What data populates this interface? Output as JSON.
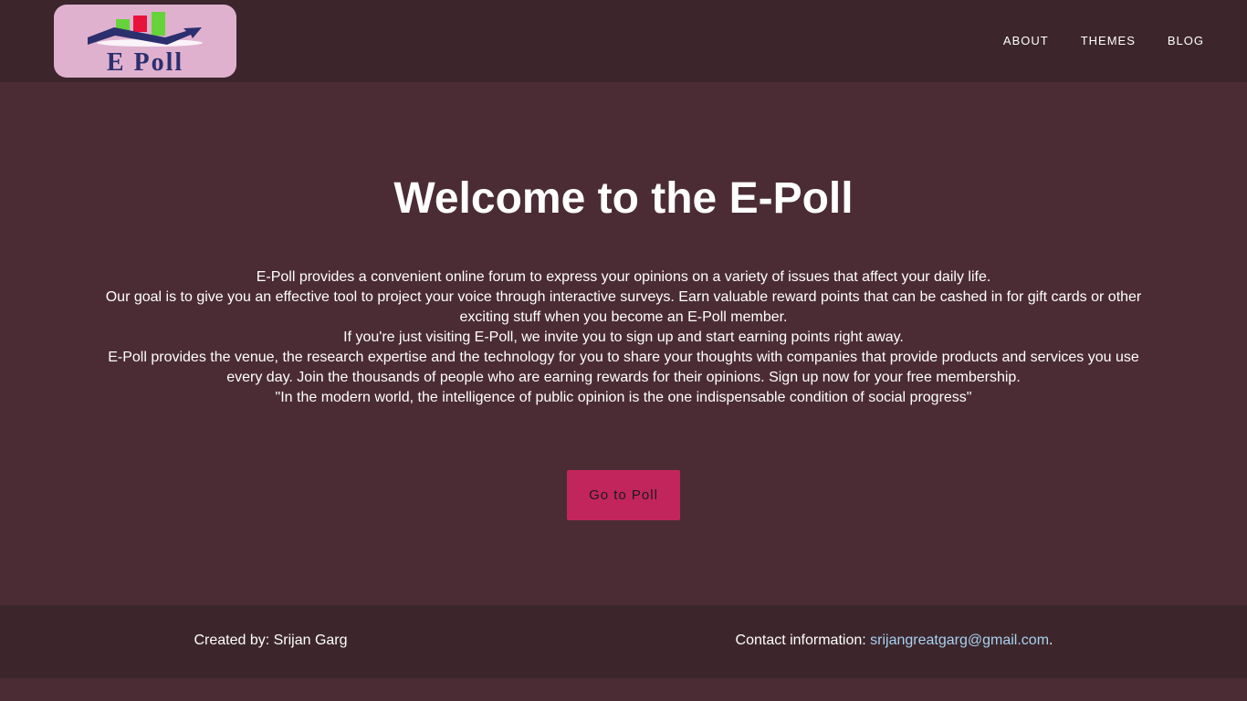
{
  "header": {
    "logo_text": "E Poll",
    "nav": [
      {
        "label": "ABOUT"
      },
      {
        "label": "THEMES"
      },
      {
        "label": "BLOG"
      }
    ]
  },
  "main": {
    "title": "Welcome to the E-Poll",
    "paragraphs": [
      "E-Poll provides a convenient online forum to express your opinions on a variety of issues that affect your daily life.",
      "Our goal is to give you an effective tool to project your voice through interactive surveys. Earn valuable reward points that can be cashed in for gift cards or other exciting stuff when you become an E-Poll member.",
      "If you're just visiting E-Poll, we invite you to sign up and start earning points right away.",
      "E-Poll provides the venue, the research expertise and the technology for you to share your thoughts with companies that provide products and services you use every day. Join the thousands of people who are earning rewards for their opinions. Sign up now for your free membership.",
      "\"In the modern world, the intelligence of public opinion is the one indispensable condition of social progress\""
    ],
    "cta_label": "Go to Poll"
  },
  "footer": {
    "created_by": "Created by: Srijan Garg",
    "contact_label": "Contact information: ",
    "contact_email": "srijangreatgarg@gmail.com",
    "contact_suffix": "."
  },
  "colors": {
    "background": "#4b2c35",
    "nav_background": "#3c262c",
    "button": "#c2255c",
    "link": "#a9d2ef",
    "logo_background": "#dfb1cf"
  }
}
